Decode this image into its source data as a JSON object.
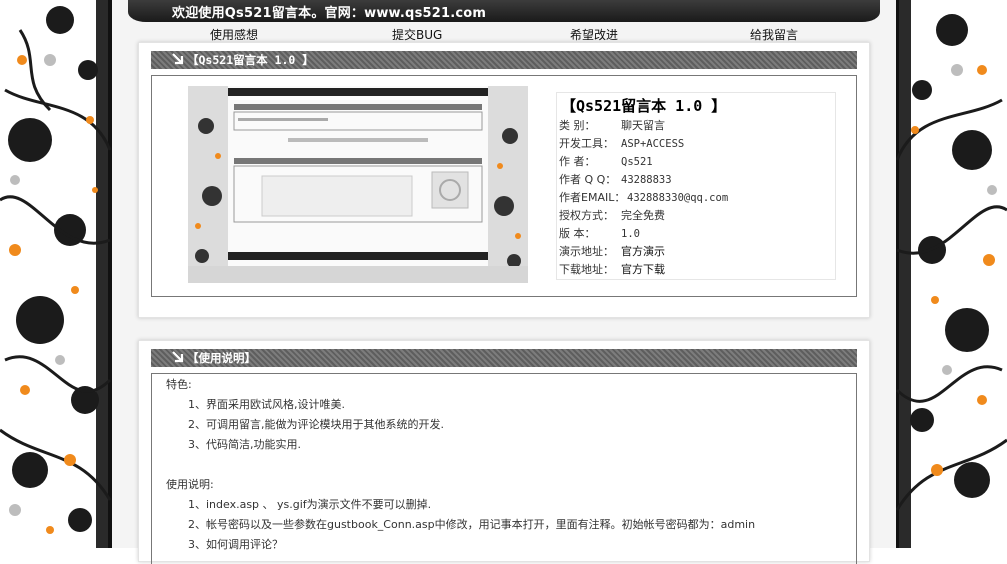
{
  "header": {
    "banner": "欢迎使用Qs521留言本。官网：www.qs521.com"
  },
  "nav": {
    "items": [
      "使用感想",
      "提交BUG",
      "希望改进",
      "给我留言"
    ]
  },
  "panel1": {
    "title": "【Qs521留言本 1.0 】",
    "info": {
      "name": "【Qs521留言本 1.0 】",
      "rows": [
        {
          "label": "类    别：",
          "value": "聊天留言"
        },
        {
          "label": "开发工具：",
          "value": "ASP+ACCESS"
        },
        {
          "label": "作    者：",
          "value": "Qs521"
        },
        {
          "label": "作者 Q Q：",
          "value": "43288833"
        },
        {
          "label": "作者EMAIL：",
          "value": "432888330@qq.com"
        },
        {
          "label": "授权方式：",
          "value": "完全免费"
        },
        {
          "label": "版    本：",
          "value": "1.0"
        },
        {
          "label": "演示地址：",
          "link": "官方演示"
        },
        {
          "label": "下载地址：",
          "link": "官方下载"
        }
      ]
    }
  },
  "panel2": {
    "title": "【使用说明】",
    "features_heading": "特色:",
    "features": [
      "1、界面采用欧试风格,设计唯美.",
      "2、可调用留言,能做为评论模块用于其他系统的开发.",
      "3、代码简洁,功能实用."
    ],
    "usage_heading": "使用说明:",
    "usage": [
      "1、index.asp 、 ys.gif为演示文件不要可以删掉.",
      "2、帐号密码以及一些参数在gustbook_Conn.asp中修改，用记事本打开，里面有注释。初始帐号密码都为：admin",
      "3、如何调用评论？"
    ]
  }
}
